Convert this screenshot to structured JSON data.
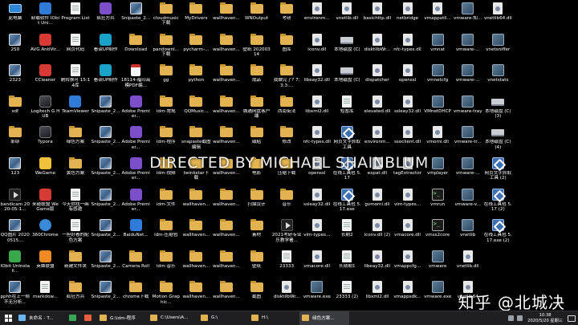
{
  "desktop_columns": [
    [
      {
        "label": "此电脑",
        "icon": "this-pc-icon",
        "style": "pc"
      },
      {
        "label": "250",
        "icon": "image-file-icon",
        "style": "img"
      },
      {
        "label": "2323",
        "icon": "image-file-icon",
        "style": "img"
      },
      {
        "label": "sdf",
        "icon": "folder-icon",
        "style": "folder"
      },
      {
        "label": "耶耶",
        "icon": "folder-icon",
        "style": "folder"
      },
      {
        "label": "123",
        "icon": "image-file-icon",
        "style": "img"
      },
      {
        "label": "bandicam 2020-05-1...",
        "icon": "video-file-icon",
        "style": "video"
      },
      {
        "label": "QQ图片 20200515...",
        "icon": "image-file-icon",
        "style": "img"
      },
      {
        "label": "IObit Uninstall...",
        "icon": "iobit-uninstaller-icon",
        "style": "app green"
      },
      {
        "label": "pphh在上一帧不无分析...",
        "icon": "image-file-icon",
        "style": "img"
      }
    ],
    [
      {
        "label": "卸载软件 IObit Uni...",
        "icon": "iobit-uninstaller-icon",
        "style": "app blue"
      },
      {
        "label": "AVG AntiVir...",
        "icon": "avg-antivirus-icon",
        "style": "app red"
      },
      {
        "label": "CCleaner",
        "icon": "ccleaner-icon",
        "style": "app red"
      },
      {
        "label": "Logitech G HUB",
        "icon": "logitech-ghub-icon",
        "style": "app dark"
      },
      {
        "label": "Typora",
        "icon": "typora-icon",
        "style": "app dark"
      },
      {
        "label": "WeGame",
        "icon": "wegame-icon",
        "style": "app yellow"
      },
      {
        "label": "来砸联盟 WeGame版",
        "icon": "game-icon",
        "style": "app red"
      },
      {
        "label": "360Chrome",
        "icon": "chrome-360-icon",
        "style": "web"
      },
      {
        "label": "英雄联盟",
        "icon": "game-icon",
        "style": "app orange"
      },
      {
        "label": "markdow...",
        "icon": "text-file-icon",
        "style": "doc"
      }
    ],
    [
      {
        "label": "Program List",
        "icon": "text-file-icon",
        "style": "doc"
      },
      {
        "label": "网页代码",
        "icon": "text-file-icon",
        "style": "doc"
      },
      {
        "label": "剩转换可 15:14库",
        "icon": "text-file-icon",
        "style": "doc"
      },
      {
        "label": "TeamViewer",
        "icon": "teamviewer-icon",
        "style": "app blue"
      },
      {
        "label": "绿色方案",
        "icon": "folder-icon",
        "style": "folder"
      },
      {
        "label": "黄色方案",
        "icon": "folder-icon",
        "style": "folder"
      },
      {
        "label": "今天你找一画有感邀",
        "icon": "text-file-icon",
        "style": "doc"
      },
      {
        "label": "一担好看的配色方案",
        "icon": "text-file-icon",
        "style": "doc"
      },
      {
        "label": "新建文件夹",
        "icon": "folder-icon",
        "style": "folder"
      },
      {
        "label": "疯狂方兵",
        "icon": "folder-icon",
        "style": "folder"
      }
    ],
    [
      {
        "label": "疯狂方兵",
        "icon": "app-icon",
        "style": "app purple"
      },
      {
        "label": "看读UP制作",
        "icon": "app-icon",
        "style": "app cyan"
      },
      {
        "label": "看读UP制作",
        "icon": "app-icon",
        "style": "app cyan"
      },
      {
        "label": "Snipaste_2...",
        "icon": "image-file-icon",
        "style": "img"
      },
      {
        "label": "Snipaste_2...",
        "icon": "image-file-icon",
        "style": "img"
      },
      {
        "label": "Snipaste_2...",
        "icon": "image-file-icon",
        "style": "img"
      },
      {
        "label": "Snipaste_2...",
        "icon": "image-file-icon",
        "style": "img"
      },
      {
        "label": "Snipaste_2...",
        "icon": "image-file-icon",
        "style": "img"
      },
      {
        "label": "Snipaste_2...",
        "icon": "image-file-icon",
        "style": "img"
      },
      {
        "label": "Snipaste_2...",
        "icon": "image-file-icon",
        "style": "img"
      }
    ],
    [
      {
        "label": "Snipaste_2...",
        "icon": "image-file-icon",
        "style": "img"
      },
      {
        "label": "Download",
        "icon": "folder-icon",
        "style": "folder"
      },
      {
        "label": "18114-福印高模PDF编...",
        "icon": "pdf-file-icon",
        "style": "pdf"
      },
      {
        "label": "Adobe Premier...",
        "icon": "adobe-premiere-icon",
        "style": "app purple"
      },
      {
        "label": "Adobe Premier...",
        "icon": "adobe-premiere-icon",
        "style": "app purple"
      },
      {
        "label": "Adobe Premier...",
        "icon": "adobe-premiere-icon",
        "style": "app purple"
      },
      {
        "label": "Adobe Premier...",
        "icon": "adobe-premiere-icon",
        "style": "app purple"
      },
      {
        "label": "BaiduNet...",
        "icon": "baidu-netdisk-icon",
        "style": "app blue"
      },
      {
        "label": "Camera Roll",
        "icon": "folder-icon",
        "style": "folder"
      },
      {
        "label": "chrome下载",
        "icon": "folder-icon",
        "style": "folder"
      }
    ],
    [
      {
        "label": "cloudmusic 下载",
        "icon": "folder-icon",
        "style": "folder"
      },
      {
        "label": "pandownl... 下载",
        "icon": "folder-icon",
        "style": "folder"
      },
      {
        "label": "gg",
        "icon": "folder-icon",
        "style": "folder"
      },
      {
        "label": "idm-常规",
        "icon": "folder-icon",
        "style": "folder"
      },
      {
        "label": "idm-程序",
        "icon": "folder-icon",
        "style": "folder"
      },
      {
        "label": "idm-视频",
        "icon": "folder-icon",
        "style": "folder"
      },
      {
        "label": "idm-文件",
        "icon": "folder-icon",
        "style": "folder"
      },
      {
        "label": "idm-压缩包",
        "icon": "folder-icon",
        "style": "folder"
      },
      {
        "label": "idm-音乐",
        "icon": "folder-icon",
        "style": "folder"
      },
      {
        "label": "Motion Graphic...",
        "icon": "folder-icon",
        "style": "folder"
      }
    ],
    [
      {
        "label": "MyDrivers",
        "icon": "folder-icon",
        "style": "folder"
      },
      {
        "label": "pycharm-...",
        "icon": "folder-icon",
        "style": "folder"
      },
      {
        "label": "python",
        "icon": "folder-icon",
        "style": "folder"
      },
      {
        "label": "QQMusic...",
        "icon": "folder-icon",
        "style": "folder"
      },
      {
        "label": "snapaste截图编辑",
        "icon": "folder-icon",
        "style": "folder"
      },
      {
        "label": "twinkstar下载",
        "icon": "folder-icon",
        "style": "folder"
      },
      {
        "label": "wallhaven...",
        "icon": "folder-icon",
        "style": "folder"
      },
      {
        "label": "wallhaven...",
        "icon": "folder-icon",
        "style": "folder"
      },
      {
        "label": "wallhaven...",
        "icon": "folder-icon",
        "style": "folder"
      },
      {
        "label": "wallhaven...",
        "icon": "folder-icon",
        "style": "folder"
      }
    ],
    [
      {
        "label": "wallhaven...",
        "icon": "folder-icon",
        "style": "folder"
      },
      {
        "label": "wallhaven...",
        "icon": "folder-icon",
        "style": "folder"
      },
      {
        "label": "wallhaven...",
        "icon": "folder-icon",
        "style": "folder"
      },
      {
        "label": "wallhaven...",
        "icon": "folder-icon",
        "style": "folder"
      },
      {
        "label": "wallhaven...",
        "icon": "folder-icon",
        "style": "folder"
      },
      {
        "label": "wallhaven...",
        "icon": "folder-icon",
        "style": "folder"
      },
      {
        "label": "wallhaven...",
        "icon": "folder-icon",
        "style": "folder"
      },
      {
        "label": "wallhaven...",
        "icon": "folder-icon",
        "style": "folder"
      },
      {
        "label": "wallhaven...",
        "icon": "folder-icon",
        "style": "folder"
      },
      {
        "label": "wallhaven...",
        "icon": "folder-icon",
        "style": "folder"
      }
    ],
    [
      {
        "label": "WNOutput",
        "icon": "folder-icon",
        "style": "folder"
      },
      {
        "label": "壁纸 20200314",
        "icon": "folder-icon",
        "style": "folder"
      },
      {
        "label": "成品",
        "icon": "folder-icon",
        "style": "folder"
      },
      {
        "label": "城通网盘客户端",
        "icon": "folder-icon",
        "style": "folder"
      },
      {
        "label": "磁贴",
        "icon": "folder-icon",
        "style": "folder"
      },
      {
        "label": "电影",
        "icon": "folder-icon",
        "style": "folder"
      },
      {
        "label": "扫描设计",
        "icon": "folder-icon",
        "style": "folder"
      },
      {
        "label": "素材",
        "icon": "folder-icon",
        "style": "folder"
      },
      {
        "label": "壁纸",
        "icon": "folder-icon",
        "style": "folder"
      },
      {
        "label": "截图",
        "icon": "folder-icon",
        "style": "folder"
      }
    ],
    [
      {
        "label": "考研",
        "icon": "folder-icon",
        "style": "folder"
      },
      {
        "label": "图库",
        "icon": "folder-icon",
        "style": "folder"
      },
      {
        "label": "我做完了? 7:3:3:...",
        "icon": "folder-icon",
        "style": "folder"
      },
      {
        "label": "西南街法",
        "icon": "folder-icon",
        "style": "folder"
      },
      {
        "label": "修改",
        "icon": "folder-icon",
        "style": "folder"
      },
      {
        "label": "压缩下载",
        "icon": "folder-icon",
        "style": "folder"
      },
      {
        "label": "音乐",
        "icon": "folder-icon",
        "style": "folder"
      },
      {
        "label": "2021考研专业乐教学署...",
        "icon": "video-file-icon",
        "style": "video"
      },
      {
        "label": "23333",
        "icon": "text-file-icon",
        "style": "doc"
      },
      {
        "label": "disktilbWr...",
        "icon": "dll-file-icon",
        "style": "dll"
      }
    ],
    [
      {
        "label": "environm...",
        "icon": "dll-file-icon",
        "style": "dll"
      },
      {
        "label": "iconv.dll",
        "icon": "dll-file-icon",
        "style": "dll"
      },
      {
        "label": "libeay32.dll",
        "icon": "dll-file-icon",
        "style": "dll"
      },
      {
        "label": "libxml2.dll",
        "icon": "dll-file-icon",
        "style": "dll"
      },
      {
        "label": "nfc-types.dll",
        "icon": "dll-file-icon",
        "style": "dll"
      },
      {
        "label": "openssl",
        "icon": "dll-file-icon",
        "style": "dll"
      },
      {
        "label": "ssleay32.dll",
        "icon": "dll-file-icon",
        "style": "dll"
      },
      {
        "label": "vim-types...",
        "icon": "dll-file-icon",
        "style": "dll"
      },
      {
        "label": "vmacore.dll",
        "icon": "dll-file-icon",
        "style": "dll"
      },
      {
        "label": "vmware.exe",
        "icon": "vmware-icon",
        "style": "vmw"
      }
    ],
    [
      {
        "label": "vnetlib.dll",
        "icon": "dll-file-icon",
        "style": "dll"
      },
      {
        "label": "本地磁盘 (C)",
        "icon": "drive-icon",
        "style": "drive"
      },
      {
        "label": "本地磁盘 (C)",
        "icon": "drive-icon",
        "style": "drive"
      },
      {
        "label": "短暂库",
        "icon": "text-file-icon",
        "style": "doc"
      },
      {
        "label": "网页文字抓取工具",
        "icon": "tool-icon",
        "style": "tool"
      },
      {
        "label": "在线工具包 5.17",
        "icon": "tool-icon",
        "style": "tool"
      },
      {
        "label": "在线工具包 5.17.exe",
        "icon": "tool-icon",
        "style": "tool"
      },
      {
        "label": "长期2",
        "icon": "text-file-icon",
        "style": "doc"
      },
      {
        "label": "长期期1",
        "icon": "text-file-icon",
        "style": "doc"
      },
      {
        "label": "23333 (2)",
        "icon": "text-file-icon",
        "style": "doc"
      }
    ],
    [
      {
        "label": "basichttp.dll",
        "icon": "dll-file-icon",
        "style": "dll"
      },
      {
        "label": "disktilbWr...",
        "icon": "dll-file-icon",
        "style": "dll"
      },
      {
        "label": "dispatcher",
        "icon": "dll-file-icon",
        "style": "dll"
      },
      {
        "label": "elevated.dll",
        "icon": "dll-file-icon",
        "style": "dll"
      },
      {
        "label": "environm...",
        "icon": "dll-file-icon",
        "style": "dll"
      },
      {
        "label": "expat.dll",
        "icon": "dll-file-icon",
        "style": "dll"
      },
      {
        "label": "gvmomi.dll",
        "icon": "dll-file-icon",
        "style": "dll"
      },
      {
        "label": "iconv.dll (2)",
        "icon": "dll-file-icon",
        "style": "dll"
      },
      {
        "label": "libeay32.dll",
        "icon": "dll-file-icon",
        "style": "dll"
      },
      {
        "label": "libxml2.dll",
        "icon": "dll-file-icon",
        "style": "dll"
      }
    ],
    [
      {
        "label": "netbridge",
        "icon": "dll-file-icon",
        "style": "dll"
      },
      {
        "label": "nfc-types.dll",
        "icon": "dll-file-icon",
        "style": "dll"
      },
      {
        "label": "openssl",
        "icon": "dll-file-icon",
        "style": "dll"
      },
      {
        "label": "ssleay32.dll",
        "icon": "dll-file-icon",
        "style": "dll"
      },
      {
        "label": "ssoclient.dll",
        "icon": "dll-file-icon",
        "style": "dll"
      },
      {
        "label": "tagExtractor",
        "icon": "dll-file-icon",
        "style": "dll"
      },
      {
        "label": "vim-types...",
        "icon": "dll-file-icon",
        "style": "dll"
      },
      {
        "label": "vmacore.dll",
        "icon": "dll-file-icon",
        "style": "dll"
      },
      {
        "label": "vmappcfg...",
        "icon": "dll-file-icon",
        "style": "dll"
      },
      {
        "label": "vmappsdk...",
        "icon": "dll-file-icon",
        "style": "dll"
      }
    ],
    [
      {
        "label": "vmapputil...",
        "icon": "dll-file-icon",
        "style": "dll"
      },
      {
        "label": "vmnat",
        "icon": "vmware-icon",
        "style": "vmw"
      },
      {
        "label": "vmnetcfg",
        "icon": "vmware-icon",
        "style": "vmw"
      },
      {
        "label": "VMnetDHCP",
        "icon": "vmware-icon",
        "style": "vmw"
      },
      {
        "label": "vmomi.dll",
        "icon": "dll-file-icon",
        "style": "dll"
      },
      {
        "label": "vmplayer",
        "icon": "vmware-icon",
        "style": "vmw"
      },
      {
        "label": "vmrun",
        "icon": "terminal-icon",
        "style": "term"
      },
      {
        "label": "vmss2core",
        "icon": "terminal-icon",
        "style": "term"
      },
      {
        "label": "vmware",
        "icon": "vmware-icon",
        "style": "vmw"
      },
      {
        "label": "vmware.exe",
        "icon": "vmware-icon",
        "style": "vmw"
      }
    ],
    [
      {
        "label": "vmware-知...",
        "icon": "vmware-icon",
        "style": "vmw"
      },
      {
        "label": "vmware-...",
        "icon": "vmware-icon",
        "style": "vmw"
      },
      {
        "label": "vmware-...",
        "icon": "vmware-icon",
        "style": "vmw"
      },
      {
        "label": "vmware-tray",
        "icon": "vmware-icon",
        "style": "vmw"
      },
      {
        "label": "vmware-tr...",
        "icon": "vmware-icon",
        "style": "vmw"
      },
      {
        "label": "vmware-...",
        "icon": "vmware-icon",
        "style": "vmw"
      },
      {
        "label": "vmware-v...",
        "icon": "vmware-icon",
        "style": "vmw"
      },
      {
        "label": "vnetlib",
        "icon": "vmware-icon",
        "style": "vmw"
      },
      {
        "label": "vnetlib.dll",
        "icon": "dll-file-icon",
        "style": "dll"
      },
      {
        "label": "vnetlib64",
        "icon": "dll-file-icon",
        "style": "dll"
      }
    ],
    [
      {
        "label": "vnetlib64.dll",
        "icon": "dll-file-icon",
        "style": "dll"
      },
      {
        "label": "vnetsniffer",
        "icon": "vmware-icon",
        "style": "vmw"
      },
      {
        "label": "vnetstats",
        "icon": "vmware-icon",
        "style": "vmw"
      },
      {
        "label": "本地磁盘 (C) (3)",
        "icon": "drive-icon",
        "style": "drive"
      },
      {
        "label": "本地磁盘 (C) (4)",
        "icon": "drive-icon",
        "style": "drive"
      },
      {
        "label": "网页文字抓取工具 (2)",
        "icon": "tool-icon",
        "style": "tool"
      },
      {
        "label": "在线工具包 5.17 (2)",
        "icon": "tool-icon",
        "style": "tool"
      },
      {
        "label": "在线工具包 5.17.exe (2)",
        "icon": "tool-icon",
        "style": "tool"
      },
      {
        "label": "",
        "icon": "blank-icon",
        "style": "none"
      },
      {
        "label": "",
        "icon": "blank-icon",
        "style": "none"
      }
    ]
  ],
  "overlay_text": "DIRECTED BY MICHAEL SHAINBLUM",
  "watermark": "知乎 @北城决",
  "taskbar": {
    "items": [
      {
        "label": "未命名 - T...",
        "icon_color": "#6cb4ee",
        "active": false
      },
      {
        "label": "",
        "icon_color": "#3aa757",
        "active": false
      },
      {
        "label": "",
        "icon_color": "#e85c41",
        "active": false
      },
      {
        "label": "G:\\idm-程序",
        "icon_color": "#e2b350",
        "active": false
      },
      {
        "label": "C:\\Users\\A...",
        "icon_color": "#e2b350",
        "active": false
      },
      {
        "label": "G:\\",
        "icon_color": "#e2b350",
        "active": false
      },
      {
        "label": "H:\\",
        "icon_color": "#e2b350",
        "active": false
      },
      {
        "label": "绿色方案...",
        "icon_color": "#e2b350",
        "active": true
      }
    ],
    "clock_time": "10:38",
    "clock_date": "2020/5/20 星期三"
  }
}
